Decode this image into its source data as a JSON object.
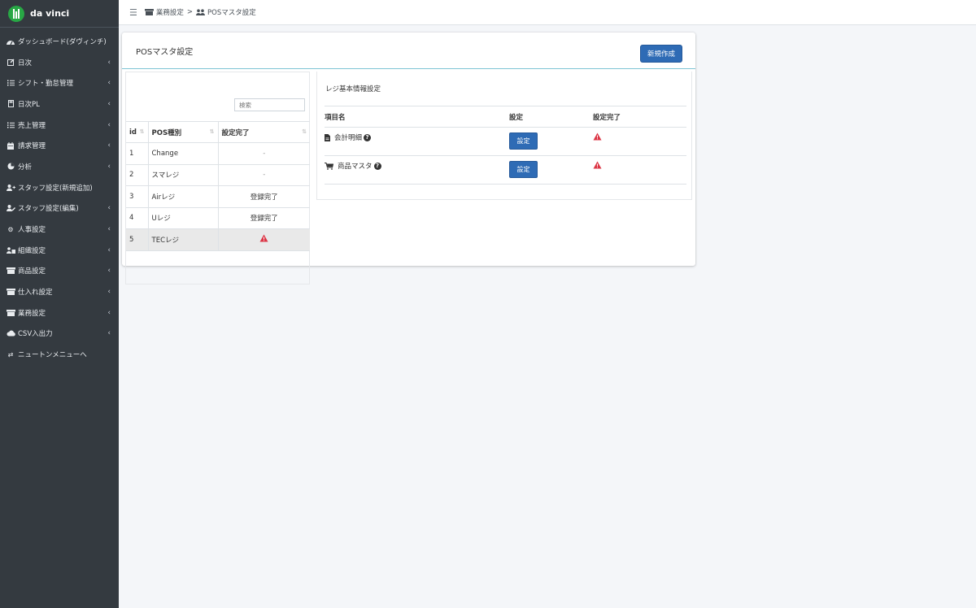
{
  "brand": {
    "name": "da vinci"
  },
  "sidebar": {
    "items": [
      {
        "label": "ダッシュボード(ダヴィンチ)",
        "icon": "dashboard-icon",
        "caret": false
      },
      {
        "label": "日次",
        "icon": "edit-icon",
        "caret": true
      },
      {
        "label": "シフト・勤怠管理",
        "icon": "list-icon",
        "caret": true
      },
      {
        "label": "日次PL",
        "icon": "calculator-icon",
        "caret": true
      },
      {
        "label": "売上管理",
        "icon": "list-icon",
        "caret": true
      },
      {
        "label": "請求管理",
        "icon": "calendar-icon",
        "caret": true
      },
      {
        "label": "分析",
        "icon": "pie-chart-icon",
        "caret": true
      },
      {
        "label": "スタッフ設定(新規追加)",
        "icon": "user-plus-icon",
        "caret": false
      },
      {
        "label": "スタッフ設定(編集)",
        "icon": "user-edit-icon",
        "caret": true
      },
      {
        "label": "人事設定",
        "icon": "gear-icon",
        "caret": true
      },
      {
        "label": "組織設定",
        "icon": "users-icon",
        "caret": true
      },
      {
        "label": "商品設定",
        "icon": "store-icon",
        "caret": true
      },
      {
        "label": "仕入れ設定",
        "icon": "store-icon",
        "caret": true
      },
      {
        "label": "業務設定",
        "icon": "store-icon",
        "caret": true
      },
      {
        "label": "CSV入出力",
        "icon": "cloud-icon",
        "caret": true
      },
      {
        "label": "ニュートンメニューへ",
        "icon": "exchange-icon",
        "caret": false
      }
    ]
  },
  "breadcrumb": {
    "parent": "業務設定",
    "separator": ">",
    "current": "POSマスタ設定"
  },
  "card": {
    "title": "POSマスタ設定",
    "new_button": "新規作成"
  },
  "pos_table": {
    "search_placeholder": "検索",
    "headers": [
      "id",
      "POS種別",
      "設定完了"
    ],
    "rows": [
      {
        "id": "1",
        "type": "Change",
        "status": "-",
        "warn": false
      },
      {
        "id": "2",
        "type": "スマレジ",
        "status": "-",
        "warn": false
      },
      {
        "id": "3",
        "type": "Airレジ",
        "status": "登録完了",
        "warn": false
      },
      {
        "id": "4",
        "type": "Uレジ",
        "status": "登録完了",
        "warn": false
      },
      {
        "id": "5",
        "type": "TECレジ",
        "status": "",
        "warn": true
      }
    ]
  },
  "register": {
    "title": "レジ基本情報設定",
    "headers": {
      "item": "項目名",
      "setting": "設定",
      "done": "設定完了"
    },
    "rows": [
      {
        "label": "会計明細",
        "icon": "file-icon",
        "button": "設定"
      },
      {
        "label": "商品マスタ",
        "icon": "cart-icon",
        "button": "設定"
      }
    ]
  },
  "colors": {
    "sidebar": "#343a40",
    "primary": "#2e6bb5",
    "warning": "#dc3545"
  }
}
